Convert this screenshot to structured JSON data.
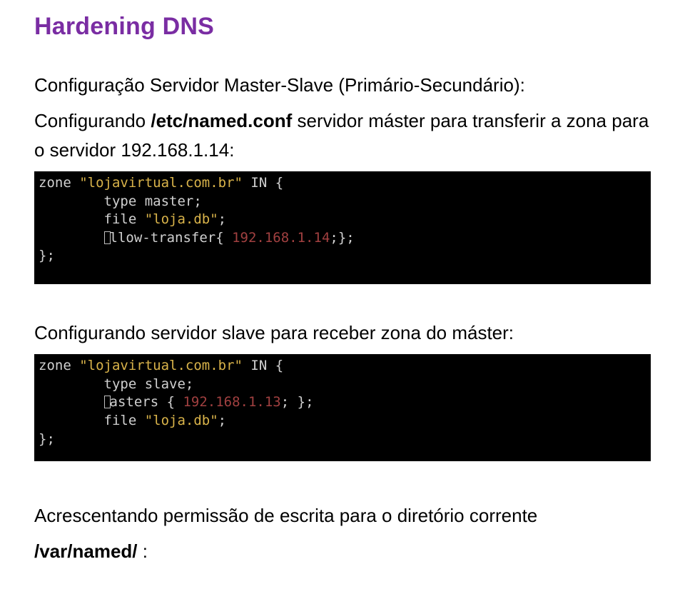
{
  "title": "Hardening DNS",
  "intro": {
    "line1": "Configuração Servidor Master-Slave (Primário-Secundário):",
    "confA": "Configurando ",
    "confFile": "/etc/named.conf",
    "confB": " servidor máster para transferir a zona para o servidor 192.168.1.14:"
  },
  "term1": {
    "l1a": "zone ",
    "l1s": "\"lojavirtual.com.br\"",
    "l1b": " IN {",
    "l2": "        type master;",
    "l3a": "        file ",
    "l3s": "\"loja.db\"",
    "l3b": ";",
    "l4a": "        ",
    "l4cursor": true,
    "l4b": "llow-transfer{ ",
    "l4n": "192.168.1.14",
    "l4c": ";};",
    "l5": "};"
  },
  "between": "Configurando servidor slave para receber zona do máster:",
  "term2": {
    "l1a": "zone ",
    "l1s": "\"lojavirtual.com.br\"",
    "l1b": " IN {",
    "l2": "        type slave;",
    "l3a": "        ",
    "l3cursor": true,
    "l3b": "asters { ",
    "l3n": "192.168.1.13",
    "l3c": "; };",
    "l4a": "        file ",
    "l4s": "\"loja.db\"",
    "l4b": ";",
    "l5": "};"
  },
  "outro": {
    "a": "Acrescentando permissão de escrita para o diretório corrente",
    "b1": "/var/named/",
    "b2": " :"
  }
}
